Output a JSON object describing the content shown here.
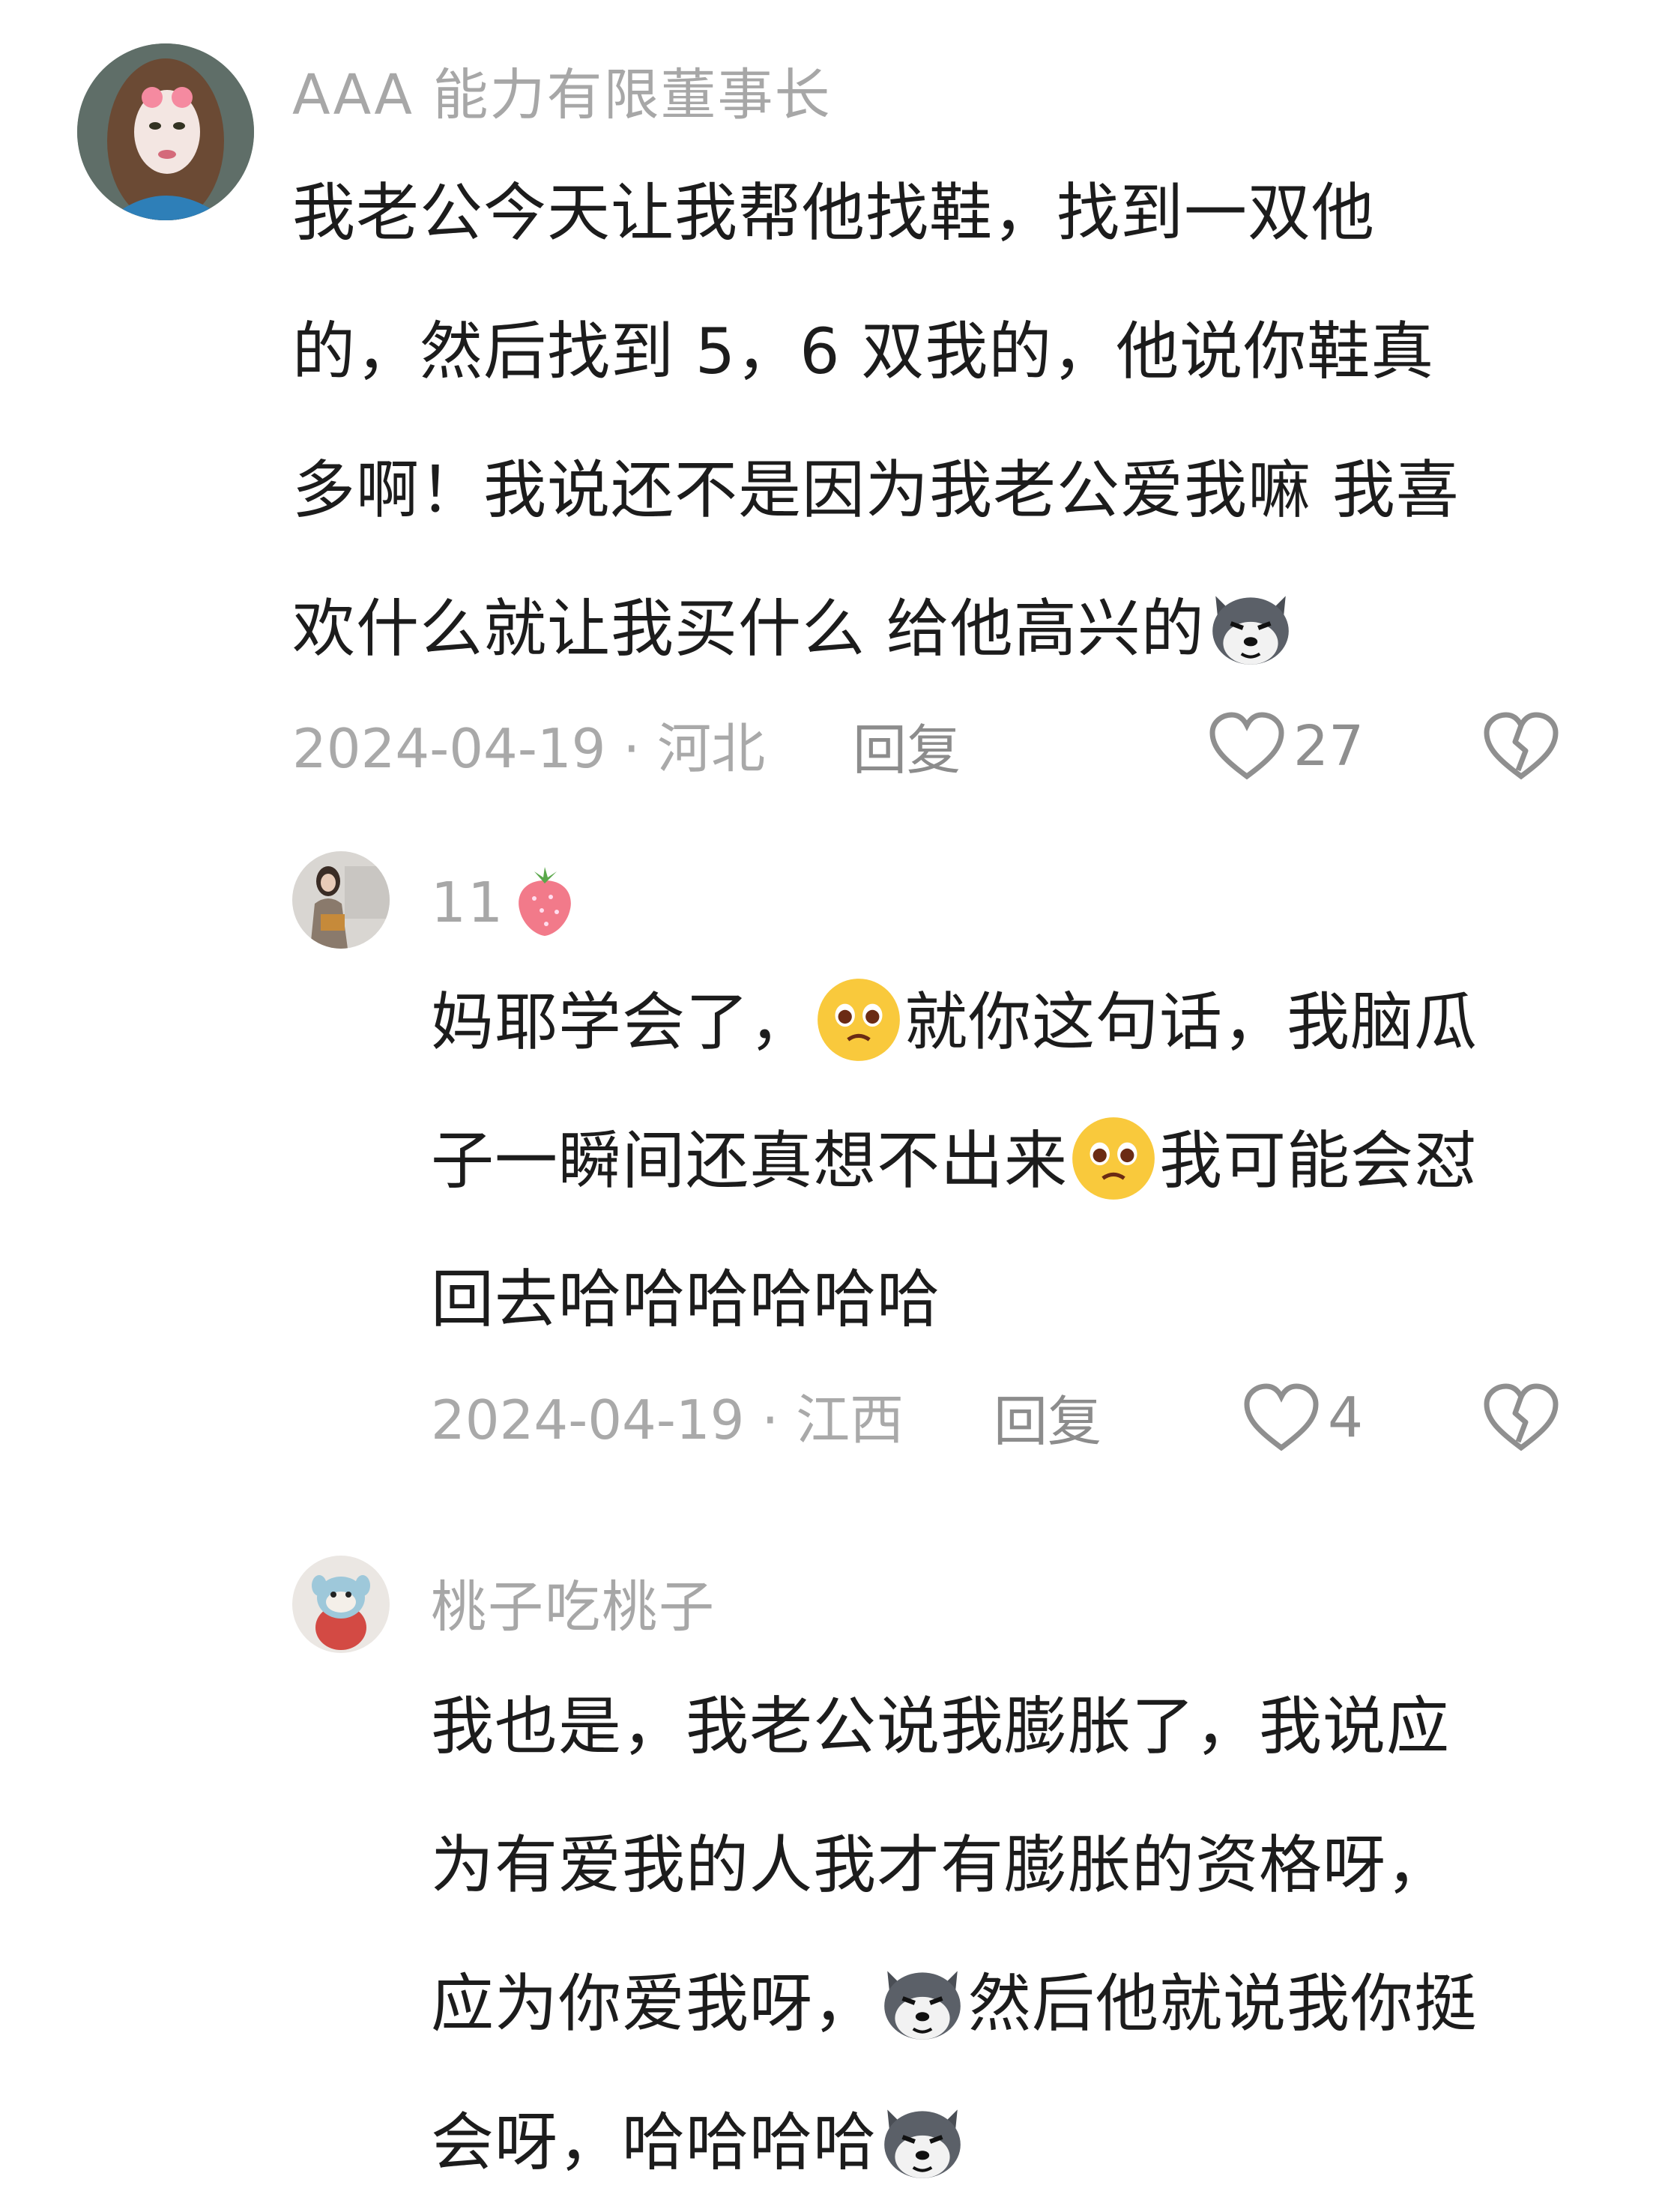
{
  "comments": [
    {
      "username": "AAA 能力有限董事长",
      "lines": [
        [
          "我老公今天让我帮他找鞋，找到一双他"
        ],
        [
          "的，然后找到 5，6 双我的，他说你鞋真"
        ],
        [
          "多啊！我说还不是因为我老公爱我嘛 我喜"
        ],
        [
          "欢什么就让我买什么  给他高兴的",
          "husky-emoji"
        ]
      ],
      "date_location": "2024-04-19 · 河北",
      "reply_label": "回复",
      "likes": "27",
      "avatar_icon": "girl-avatar-icon"
    },
    {
      "username": "11",
      "username_icon": "strawberry-icon",
      "lines": [
        [
          "妈耶学会了，",
          "pleading-face-emoji",
          "就你这句话，我脑瓜"
        ],
        [
          "子一瞬间还真想不出来",
          "pleading-face-emoji",
          "我可能会怼"
        ],
        [
          "回去哈哈哈哈哈哈"
        ]
      ],
      "date_location": "2024-04-19 · 江西",
      "reply_label": "回复",
      "likes": "4",
      "avatar_icon": "woman-photo-avatar-icon"
    },
    {
      "username": "桃子吃桃子",
      "lines": [
        [
          "我也是，我老公说我膨胀了，我说应"
        ],
        [
          "为有爱我的人我才有膨胀的资格呀，"
        ],
        [
          "应为你爱我呀，",
          "husky-emoji",
          "然后他就说我你挺"
        ],
        [
          "会呀，哈哈哈哈",
          "husky-emoji"
        ]
      ],
      "avatar_icon": "toy-mascot-avatar-icon"
    }
  ],
  "colors": {
    "username": "#a7a7a7",
    "body": "#1c1c1c",
    "meta": "#a9a9a9",
    "icon": "#8f8f8f"
  }
}
